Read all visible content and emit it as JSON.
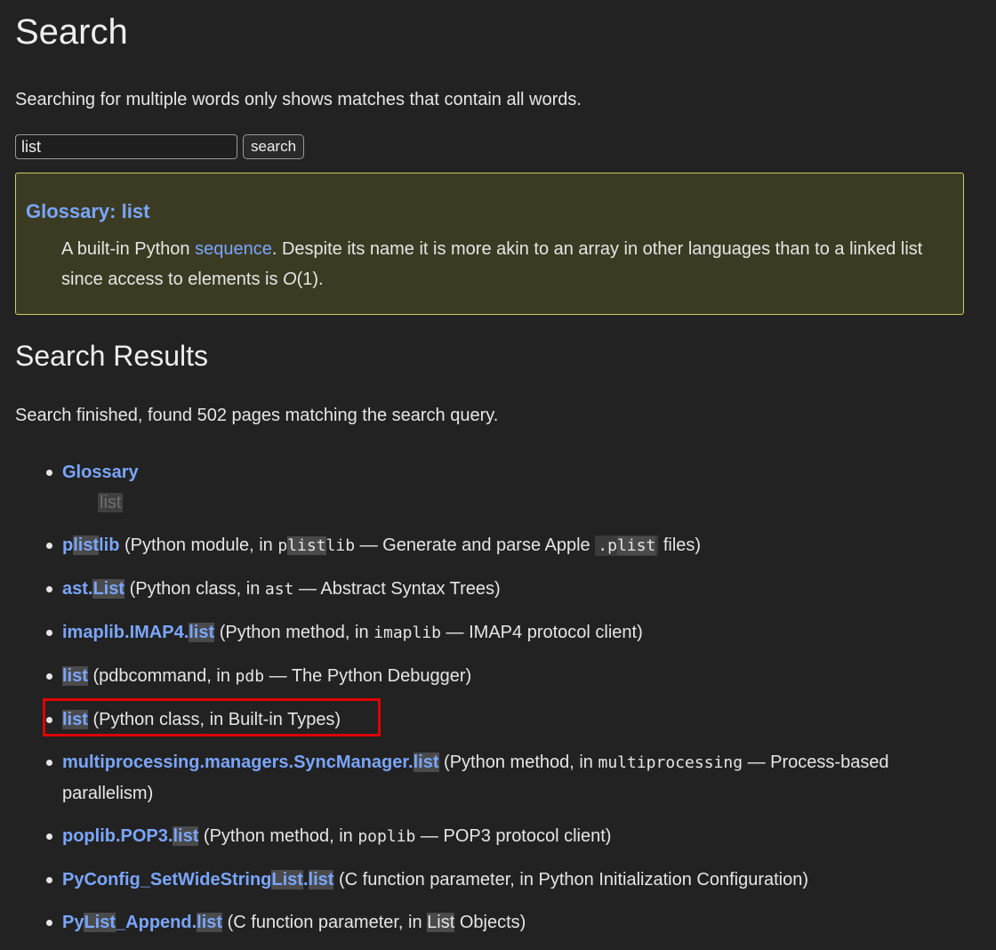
{
  "page": {
    "title": "Search",
    "hint": "Searching for multiple words only shows matches that contain all words."
  },
  "search": {
    "value": "list",
    "button_label": "search"
  },
  "glossary": {
    "title": "Glossary: list",
    "text_before": "A built-in Python ",
    "link": "sequence",
    "text_after": ". Despite its name it is more akin to an array in other languages than to a linked list since access to elements is ",
    "o_symbol": "O",
    "o_rest": "(1)."
  },
  "results": {
    "heading": "Search Results",
    "status": "Search finished, found 502 pages matching the search query.",
    "items": [
      {
        "pre": "",
        "hl": "",
        "post": "Glossary",
        "context": "list"
      },
      {
        "pre": "p",
        "hl": "list",
        "post": "lib",
        "desc_before": " (Python module, in ",
        "code_pre": "p",
        "code_hl": "list",
        "code_post": "lib",
        "desc_mid": " — Generate and parse Apple ",
        "code2_pre": ".p",
        "code2_hl": "list",
        "desc_after": " files)"
      },
      {
        "pre": "ast.",
        "hl": "List",
        "post": "",
        "desc_before": " (Python class, in ",
        "code": "ast",
        "desc_after": " — Abstract Syntax Trees)"
      },
      {
        "pre": "imaplib.IMAP4.",
        "hl": "list",
        "post": "",
        "desc_before": " (Python method, in ",
        "code": "imaplib",
        "desc_after": " — IMAP4 protocol client)"
      },
      {
        "pre": "",
        "hl": "list",
        "post": "",
        "desc_before": " (pdbcommand, in ",
        "code": "pdb",
        "desc_after": " — The Python Debugger)"
      },
      {
        "pre": "",
        "hl": "list",
        "post": "",
        "desc": " (Python class, in Built-in Types)"
      },
      {
        "pre": "multiprocessing.managers.SyncManager.",
        "hl": "list",
        "post": "",
        "desc_before": " (Python method, in ",
        "code": "multiprocessing",
        "desc_after": " — Process-based parallelism)"
      },
      {
        "pre": "poplib.POP3.",
        "hl": "list",
        "post": "",
        "desc_before": " (Python method, in ",
        "code": "poplib",
        "desc_after": " — POP3 protocol client)"
      },
      {
        "pre": "PyConfig_SetWideString",
        "hl": "List",
        "post": ".",
        "hl2": "list",
        "desc": " (C function parameter, in Python Initialization Configuration)"
      },
      {
        "pre": "Py",
        "hl": "List",
        "post": "_Append.",
        "hl2": "list",
        "desc_before": " (C function parameter, in ",
        "desc_hl": "List",
        "desc_after": " Objects)"
      }
    ]
  },
  "colors": {
    "background": "#222222",
    "link": "#7aa6ff",
    "glossary_bg": "#3b3b23",
    "glossary_border": "#cccc66",
    "annotation_box": "#e00000"
  }
}
